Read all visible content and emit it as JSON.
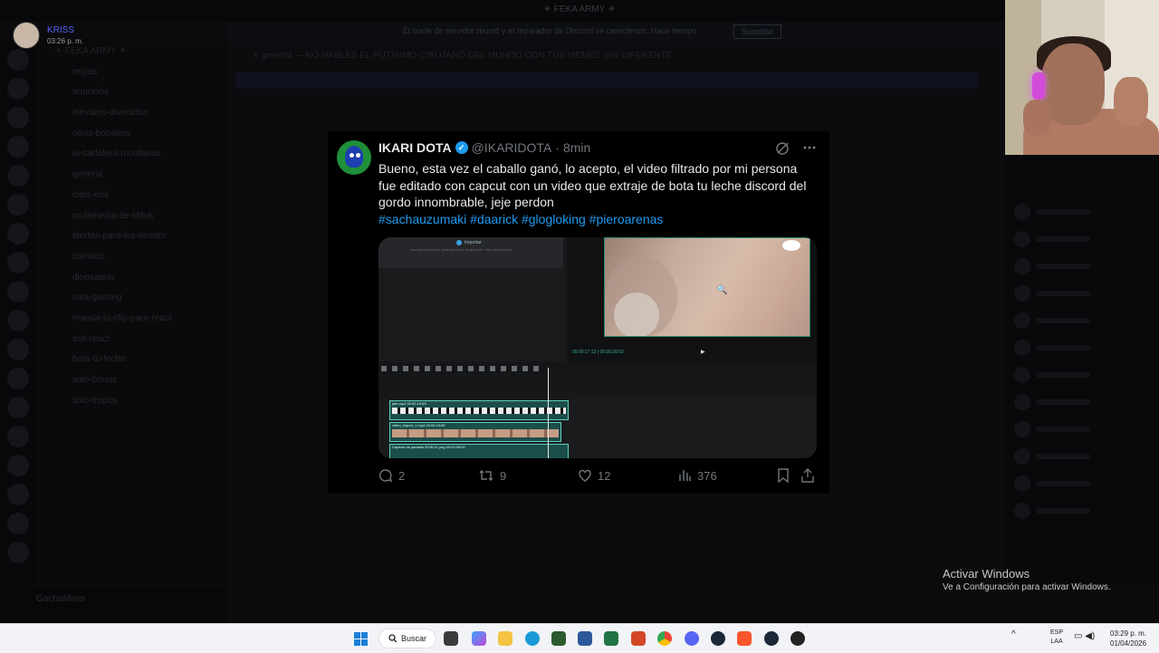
{
  "background": {
    "top_title": "☀ FEKA ARMY ☀",
    "banner_text": "El bucle de servidor reunió y el reparador de Discord se caracterizó. Hace tiempo",
    "banner_button": "Suscribir",
    "server_name": "☀ FEKA ARMY ☀",
    "channel_header": "# general — NO HABLES EL PUTÍSIMO CIRUJANO DEL MUNDO CON TUS MEMES SIN DIFERENTE",
    "channels": [
      "reglas",
      "anuncios",
      "elevates-divertidos",
      "otros-boosters",
      "la-cartelera-mordasas",
      "general",
      "clips-kick",
      "multimedia-de-tiktok",
      "alertas-para-los-stream",
      "corridos",
      "dinosaurio",
      "sala-gaming",
      "manda-tu-clip-para-react",
      "ask-react",
      "bota-tu-leche",
      "solo-bonus",
      "solo-trapos"
    ],
    "user_name": "GachaMiner"
  },
  "notification": {
    "name": "KRISS",
    "time": "03:26 p. m."
  },
  "tweet": {
    "name": "IKARI DOTA",
    "handle": "@IKARIDOTA",
    "separator": "·",
    "time": "8min",
    "text": "Bueno, esta vez el caballo ganó, lo acepto, el video filtrado por mi persona fue  editado con capcut con un video que extraje de bota tu leche discord del gordo innombrable, jeje perdon",
    "hashtags": "#sachauzumaki #daarick #glogloking  #pieroarenas",
    "media": {
      "import_label": "Importar",
      "import_hint": "Importar proyectos guardados y/o localmente. Más información",
      "timecode": "00:00:17:12  |  00:00:20:02",
      "clip1_label": "jam.mp4   00:00:19:69",
      "clip2_label": "video_import_1.mp4   00:00:19:69",
      "clip3_label": "Captura de pantalla 2026-01.png   00:00:05:00"
    },
    "actions": {
      "replies": "2",
      "reposts": "9",
      "likes": "12",
      "views": "376"
    }
  },
  "activation": {
    "title": "Activar Windows",
    "subtitle": "Ve a Configuración para activar Windows."
  },
  "taskbar": {
    "search": "Buscar",
    "lang1": "ESP",
    "lang2": "LAA",
    "time": "03:29 p. m.",
    "date": "01/04/2026"
  },
  "colors": {
    "accent_blue": "#1d9bf0",
    "background": "#000000",
    "text_primary": "#e7e9ea",
    "text_secondary": "#71767b"
  }
}
